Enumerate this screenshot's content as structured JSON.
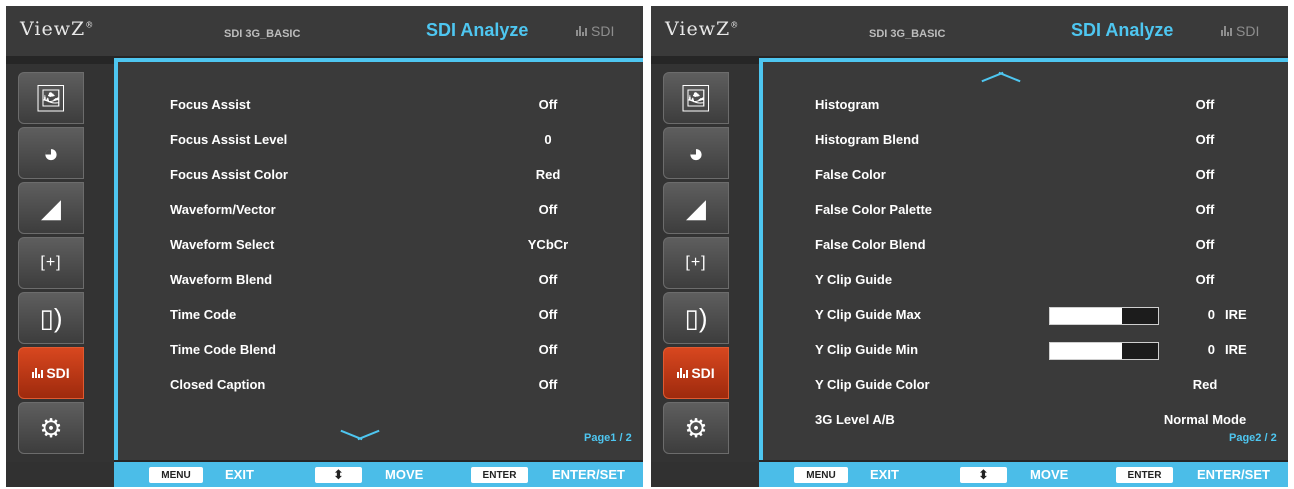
{
  "brand": {
    "logo": "ViewZ"
  },
  "left": {
    "mode": "SDI 3G_BASIC",
    "title": "SDI Analyze",
    "top_tag": "SDI",
    "sidebar": [
      {
        "icon": "picture-icon"
      },
      {
        "icon": "color-wheel-icon"
      },
      {
        "icon": "speaker-icon"
      },
      {
        "icon": "marker-icon"
      },
      {
        "icon": "remote-signal-icon"
      },
      {
        "icon": "sdi-bars-icon",
        "label": "SDI"
      },
      {
        "icon": "settings-gears-icon"
      }
    ],
    "rows": [
      {
        "label": "Focus Assist",
        "value": "Off"
      },
      {
        "label": "Focus Assist Level",
        "value": "0"
      },
      {
        "label": "Focus Assist Color",
        "value": "Red"
      },
      {
        "label": "Waveform/Vector",
        "value": "Off"
      },
      {
        "label": "Waveform Select",
        "value": "YCbCr"
      },
      {
        "label": "Waveform Blend",
        "value": "Off"
      },
      {
        "label": "Time Code",
        "value": "Off"
      },
      {
        "label": "Time Code Blend",
        "value": "Off"
      },
      {
        "label": "Closed Caption",
        "value": "Off"
      }
    ],
    "page": "Page1 / 2"
  },
  "right": {
    "mode": "SDI 3G_BASIC",
    "title": "SDI Analyze",
    "top_tag": "SDI",
    "rows": [
      {
        "label": "Histogram",
        "value": "Off"
      },
      {
        "label": "Histogram Blend",
        "value": "Off"
      },
      {
        "label": "False Color",
        "value": "Off"
      },
      {
        "label": "False Color Palette",
        "value": "Off"
      },
      {
        "label": "False Color Blend",
        "value": "Off"
      },
      {
        "label": "Y Clip Guide",
        "value": "Off"
      },
      {
        "label": "Y Clip Guide Max",
        "value": "0",
        "unit": "IRE",
        "level": 0.67
      },
      {
        "label": "Y Clip Guide Min",
        "value": "0",
        "unit": "IRE",
        "level": 0.67
      },
      {
        "label": "Y Clip Guide Color",
        "value": "Red"
      },
      {
        "label": "3G Level A/B",
        "value": "Normal Mode"
      }
    ],
    "page": "Page2 / 2"
  },
  "footer": {
    "menu_key": "MENU",
    "exit_label": "EXIT",
    "move_key": "⬍",
    "move_label": "MOVE",
    "enter_key": "ENTER",
    "enterset_label": "ENTER/SET"
  },
  "colors": {
    "accent": "#4ec6f0",
    "active_tab": "#c7401a",
    "panel_bg": "#3a3a3a"
  }
}
